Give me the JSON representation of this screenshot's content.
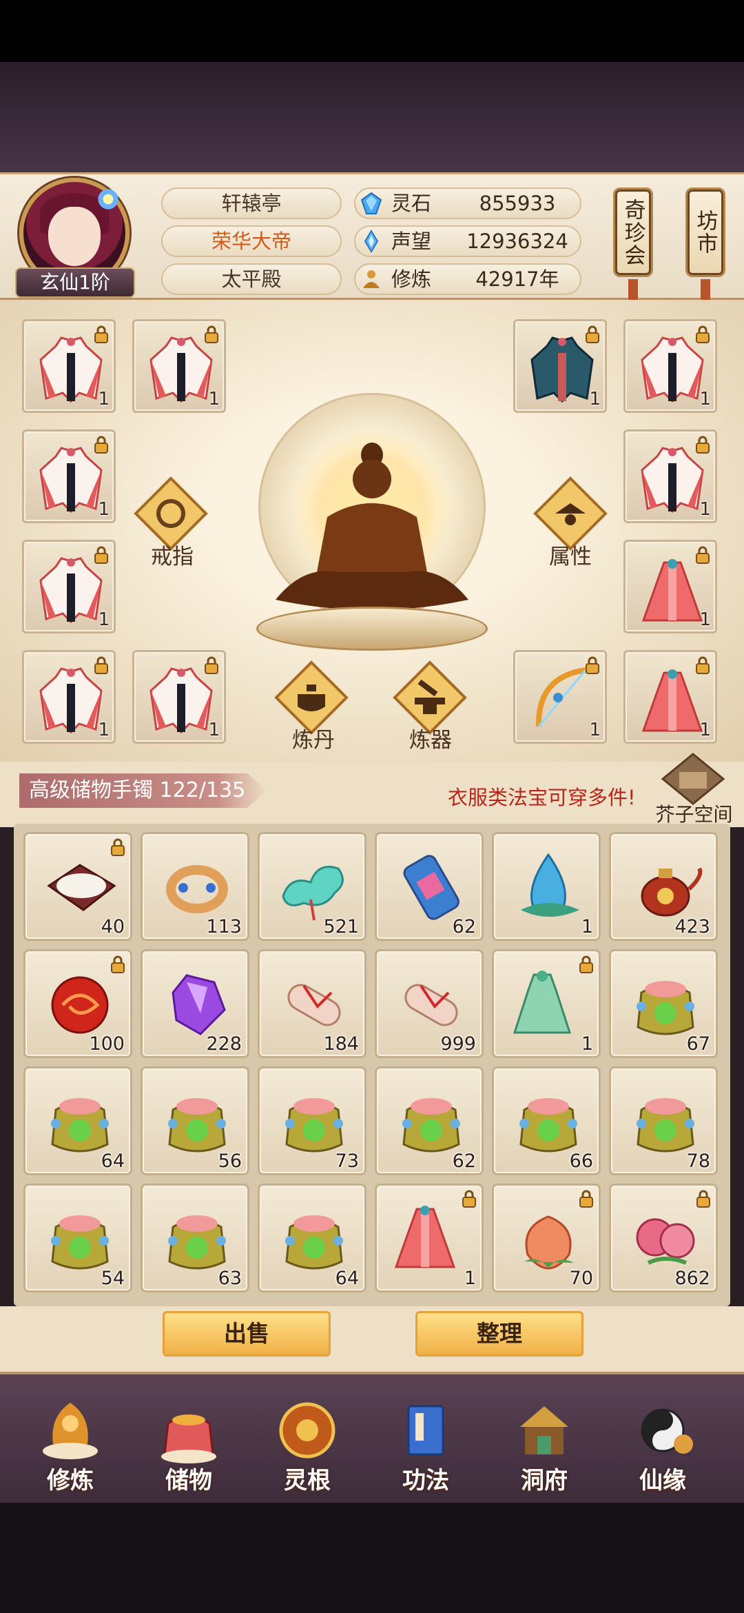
{
  "player": {
    "rank": "玄仙1阶",
    "sect": "轩辕亭",
    "title": "荣华大帝",
    "hall": "太平殿"
  },
  "resources": [
    {
      "icon": "spirit-stone-icon",
      "label": "灵石",
      "value": "855933"
    },
    {
      "icon": "reputation-icon",
      "label": "声望",
      "value": "12936324"
    },
    {
      "icon": "cultivation-icon",
      "label": "修炼",
      "value": "42917年"
    }
  ],
  "side_buttons": {
    "treasure_fair": "奇珍会",
    "market": "坊市"
  },
  "equipment": {
    "ring_label": "戒指",
    "attr_label": "属性",
    "alchemy_label": "炼丹",
    "forge_label": "炼器",
    "slots": [
      {
        "item": "white-robe",
        "count": "1",
        "locked": true
      },
      {
        "item": "white-robe",
        "count": "1",
        "locked": true
      },
      {
        "item": "blue-robe",
        "count": "1",
        "locked": true
      },
      {
        "item": "white-robe",
        "count": "1",
        "locked": true
      },
      {
        "item": "white-robe",
        "count": "1",
        "locked": true
      },
      {
        "item": "white-robe",
        "count": "1",
        "locked": true
      },
      {
        "item": "white-robe",
        "count": "1",
        "locked": true
      },
      {
        "item": "red-dress",
        "count": "1",
        "locked": true
      },
      {
        "item": "white-robe",
        "count": "1",
        "locked": true
      },
      {
        "item": "white-robe",
        "count": "1",
        "locked": true
      },
      {
        "item": "bow",
        "count": "1",
        "locked": true
      },
      {
        "item": "red-dress",
        "count": "1",
        "locked": true
      }
    ]
  },
  "bag": {
    "title": "高级储物手镯 122/135",
    "hint": "衣服类法宝可穿多件!",
    "mustard_space": "芥子空间",
    "items": [
      {
        "item": "rice-basket",
        "count": "40",
        "locked": true
      },
      {
        "item": "jeweled-ring",
        "count": "113",
        "locked": false
      },
      {
        "item": "jade-cloud",
        "count": "521",
        "locked": false
      },
      {
        "item": "scroll-tube",
        "count": "62",
        "locked": false
      },
      {
        "item": "water-spirit",
        "count": "1",
        "locked": false
      },
      {
        "item": "teapot",
        "count": "423",
        "locked": false
      },
      {
        "item": "red-orb",
        "count": "100",
        "locked": true
      },
      {
        "item": "purple-crystal",
        "count": "228",
        "locked": false
      },
      {
        "item": "paper-scroll",
        "count": "184",
        "locked": false
      },
      {
        "item": "paper-scroll",
        "count": "999",
        "locked": false
      },
      {
        "item": "green-robe",
        "count": "1",
        "locked": true
      },
      {
        "item": "lucky-bag",
        "count": "67",
        "locked": false
      },
      {
        "item": "lucky-bag",
        "count": "64",
        "locked": false
      },
      {
        "item": "lucky-bag",
        "count": "56",
        "locked": false
      },
      {
        "item": "lucky-bag",
        "count": "73",
        "locked": false
      },
      {
        "item": "lucky-bag",
        "count": "62",
        "locked": false
      },
      {
        "item": "lucky-bag",
        "count": "66",
        "locked": false
      },
      {
        "item": "lucky-bag",
        "count": "78",
        "locked": false
      },
      {
        "item": "lucky-bag",
        "count": "54",
        "locked": false
      },
      {
        "item": "lucky-bag",
        "count": "63",
        "locked": false
      },
      {
        "item": "lucky-bag",
        "count": "64",
        "locked": false
      },
      {
        "item": "red-dress",
        "count": "1",
        "locked": true
      },
      {
        "item": "peach",
        "count": "70",
        "locked": true
      },
      {
        "item": "pink-fruit",
        "count": "862",
        "locked": true
      }
    ]
  },
  "actions": {
    "sell": "出售",
    "sort": "整理"
  },
  "nav": [
    {
      "icon": "cultivate-icon",
      "label": "修炼"
    },
    {
      "icon": "storage-icon",
      "label": "储物"
    },
    {
      "icon": "spirit-root-icon",
      "label": "灵根"
    },
    {
      "icon": "technique-icon",
      "label": "功法"
    },
    {
      "icon": "cave-icon",
      "label": "洞府"
    },
    {
      "icon": "fate-icon",
      "label": "仙缘"
    }
  ],
  "colors": {
    "title_gold": "#d25a1a",
    "hint_red": "#b7261c",
    "button_gold": "#f0b047"
  }
}
